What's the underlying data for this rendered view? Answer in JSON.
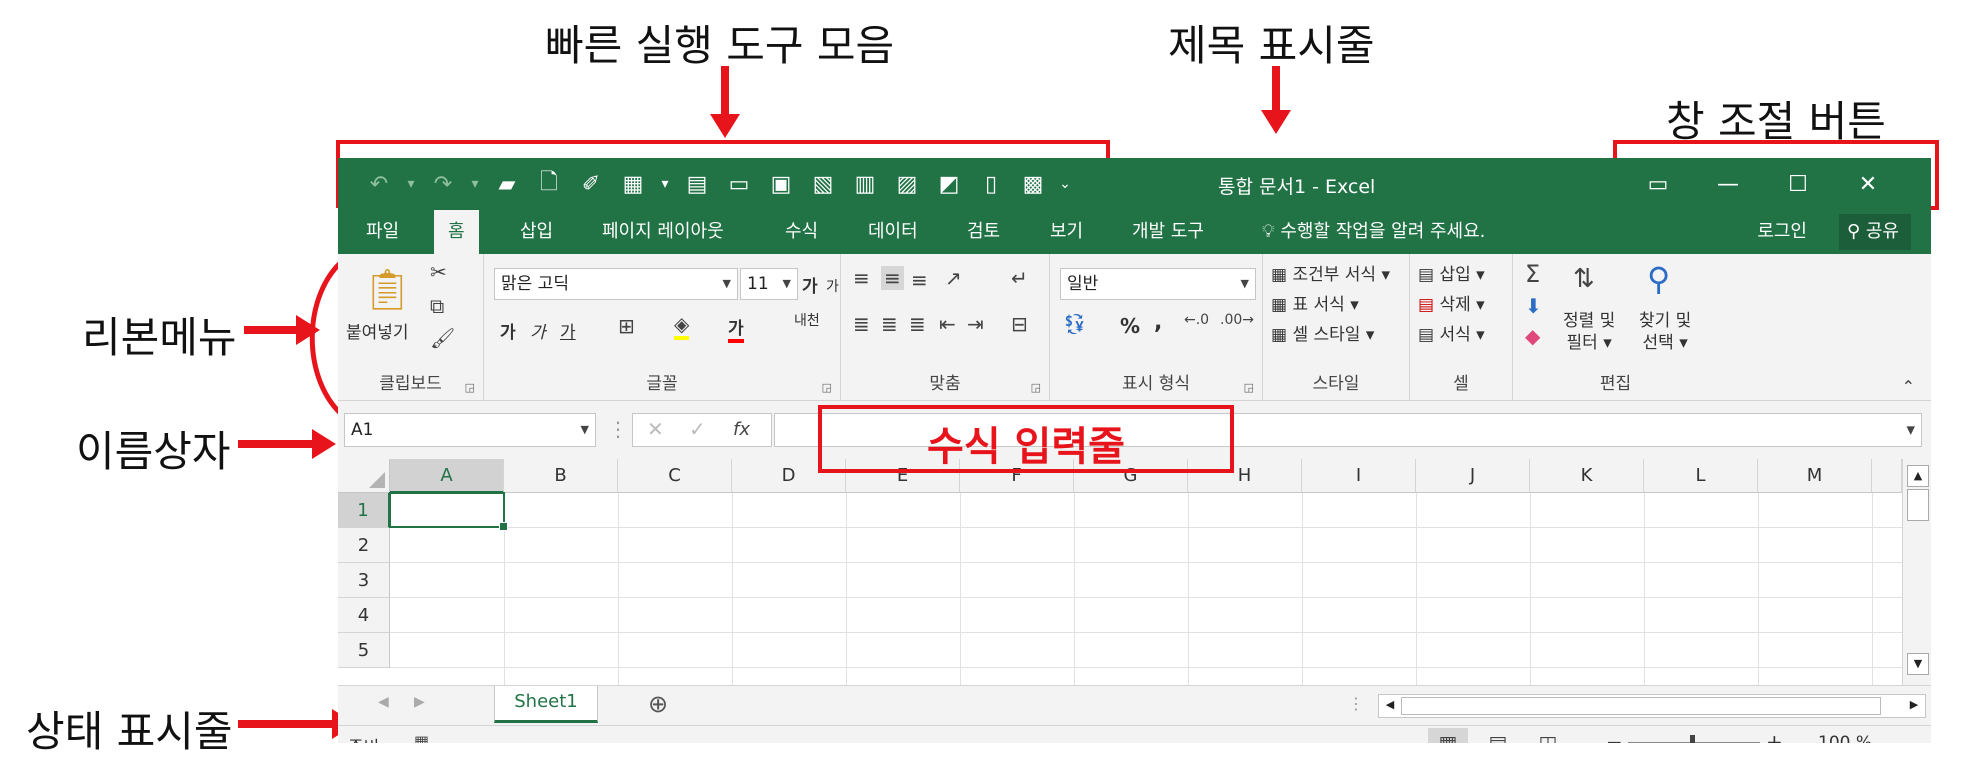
{
  "annotations": {
    "qat": "빠른 실행 도구 모음",
    "title_bar": "제목 표시줄",
    "window_controls": "창 조절 버튼",
    "ribbon": "리본메뉴",
    "name_box": "이름상자",
    "formula_bar": "수식 입력줄",
    "status_bar": "상태 표시줄"
  },
  "window": {
    "title": "통합 문서1 - Excel"
  },
  "tabs": [
    "파일",
    "홈",
    "삽입",
    "페이지 레이아웃",
    "수식",
    "데이터",
    "검토",
    "보기",
    "개발 도구"
  ],
  "tell_me": "수행할 작업을 알려 주세요.",
  "account": {
    "login": "로그인",
    "share": "공유"
  },
  "ribbon": {
    "clipboard": {
      "label": "클립보드",
      "paste": "붙여넣기"
    },
    "font": {
      "label": "글꼴",
      "name": "맑은 고딕",
      "size": "11",
      "bold": "가",
      "italic": "가",
      "underline": "가",
      "color": "가",
      "increase": "가",
      "decrease": "가",
      "phonetic": "내천"
    },
    "alignment": {
      "label": "맞춤"
    },
    "number": {
      "label": "표시 형식",
      "format": "일반",
      "percent": "%",
      "comma": ","
    },
    "styles": {
      "label": "스타일",
      "conditional": "조건부 서식",
      "table": "표 서식",
      "cell": "셀 스타일"
    },
    "cells": {
      "label": "셀",
      "insert": "삽입",
      "delete": "삭제",
      "format": "서식"
    },
    "editing": {
      "label": "편집",
      "sort": "정렬 및",
      "sort2": "필터",
      "find": "찾기 및",
      "find2": "선택"
    }
  },
  "formula": {
    "name_box": "A1",
    "fx": "fx"
  },
  "grid": {
    "columns": [
      "A",
      "B",
      "C",
      "D",
      "E",
      "F",
      "G",
      "H",
      "I",
      "J",
      "K",
      "L",
      "M"
    ],
    "rows": [
      "1",
      "2",
      "3",
      "4",
      "5"
    ],
    "selected": "A1"
  },
  "sheets": [
    "Sheet1"
  ],
  "status": {
    "ready": "준비",
    "zoom": "100 %"
  },
  "colors": {
    "excel_green": "#217346",
    "annotation_red": "#e8141b"
  }
}
